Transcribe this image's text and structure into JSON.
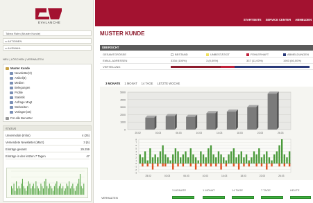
{
  "brand": {
    "name": "EVALANCHE",
    "color": "#a31230"
  },
  "left": {
    "bars": [
      "Tabea Rahn (Muster Kunde)",
      "▸ AKTIONEN",
      "▸ AUSWAHL"
    ],
    "nav_tabs": "NEU | LÖSCHEN | VERWALTEN",
    "tree_root": "Muster Kunde",
    "tree_items": [
      "Newsletter(2)",
      "Artikel(3)",
      "Medien",
      "Belegungen",
      "Profile",
      "Statistik",
      "Anfrage Mngt",
      "Webseiten",
      "Vorlagen(16)"
    ],
    "tree_footer": "Für alle Benutzer",
    "status_title": "STATUS",
    "status_rows": [
      {
        "label": "Unsermolde (Infos)",
        "value": "4 (25)"
      },
      {
        "label": "Versendete Newsletter (März)",
        "value": "3 (5)"
      },
      {
        "label": "Einträge gesamt",
        "value": "29.259"
      },
      {
        "label": "Einträge in den letzten 7 Tagen",
        "value": "47"
      }
    ]
  },
  "topnav": [
    "STARTSEITE",
    "SERVICE CENTER",
    "ABMELDEN"
  ],
  "page_title": "MUSTER KUNDE",
  "overview": {
    "header": "ÜBERSICHT",
    "legend": [
      {
        "label": "BESTAND",
        "color": "#ffffff"
      },
      {
        "label": "UNBESTÄTIGT",
        "color": "#f0e060"
      },
      {
        "label": "FEHLERHAFT",
        "color": "#c0203a"
      },
      {
        "label": "ABMELDUNGEN",
        "color": "#2a3a7a"
      }
    ],
    "row_label_1": "GESAMTGRÖSSE",
    "row_label_2": "EMAIL-ADRESSEN",
    "row_values": [
      "3334 (100%)",
      "3 (0,00%)",
      "337 (11,00%)",
      "1903 (60,00%)"
    ],
    "row_label_3": "VERTEILUNG"
  },
  "chart_tabs": [
    "3 MONATE",
    "1 MONAT",
    "14 TAGE",
    "LETZTE WOCHE"
  ],
  "chart_tabs_active": 0,
  "chart_data": [
    {
      "type": "bar",
      "title": "",
      "categories": [
        "25.02",
        "02.03",
        "06.03",
        "10.03",
        "14.03",
        "18.03",
        "22.03",
        "26.03"
      ],
      "values": [
        1600,
        1800,
        1700,
        2200,
        2400,
        3000,
        4800
      ],
      "categories_bars": [
        "25.02",
        "02.03",
        "06.03",
        "10.03",
        "14.03",
        "18.03",
        "22.03"
      ],
      "ylim": [
        0,
        5000
      ],
      "yticks": [
        0,
        1000,
        2000,
        3000,
        4000,
        5000
      ],
      "grid": true
    },
    {
      "type": "bar",
      "title": "",
      "categories": [
        "25.02",
        "02.03",
        "06.03",
        "10.03",
        "14.03",
        "18.03",
        "22.03",
        "26.03"
      ],
      "positive": [
        3,
        2,
        4,
        1,
        5,
        2,
        3,
        2,
        4,
        6,
        3,
        2,
        1,
        3,
        5,
        4,
        2,
        3,
        4,
        2,
        5,
        3,
        2,
        1,
        4,
        3,
        2,
        5,
        6,
        3,
        2,
        4,
        3,
        2,
        1,
        3,
        4,
        5,
        2,
        3,
        4,
        2,
        3,
        1,
        2,
        4,
        3,
        5,
        2,
        3,
        4,
        2,
        1,
        3,
        4,
        6,
        8,
        3,
        2,
        4
      ],
      "negative": [
        0,
        -1,
        0,
        -1,
        0,
        -2,
        0,
        -1,
        0,
        -1,
        -1,
        0,
        0,
        -2,
        0,
        -1,
        0,
        -1,
        0,
        0,
        -1,
        0,
        -2,
        0,
        -1,
        0,
        -1,
        0,
        -1,
        0,
        -1,
        0,
        -2,
        0,
        -1,
        0,
        0,
        -1,
        0,
        -2,
        0,
        -1,
        0,
        -1,
        0,
        0,
        -1,
        0,
        -1,
        0,
        -2,
        0,
        -1,
        0,
        0,
        -1,
        0,
        -1,
        0,
        -1
      ],
      "ylim": [
        -3,
        8
      ],
      "yticks": [
        -3,
        -2,
        -1,
        0,
        1,
        2,
        3,
        4,
        5,
        6,
        7,
        8
      ],
      "colors": {
        "positive": "#4a9a3a",
        "negative": "#e05020"
      }
    }
  ],
  "bottom_table": {
    "headers": [
      "3 MONATE",
      "1 MONAT",
      "14 TAGE",
      "7 TAGE",
      "HEUTE"
    ],
    "row_label": "VERHALTEN",
    "bar_color": "#3fae3f"
  }
}
